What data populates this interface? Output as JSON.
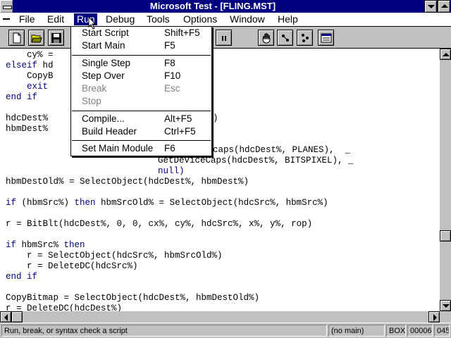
{
  "window": {
    "title": "Microsoft Test - [FLING.MST]"
  },
  "menubar": {
    "items": [
      {
        "name": "file",
        "label": "File"
      },
      {
        "name": "edit",
        "label": "Edit"
      },
      {
        "name": "run",
        "label": "Run"
      },
      {
        "name": "debug",
        "label": "Debug"
      },
      {
        "name": "tools",
        "label": "Tools"
      },
      {
        "name": "options",
        "label": "Options"
      },
      {
        "name": "window",
        "label": "Window"
      },
      {
        "name": "help",
        "label": "Help"
      }
    ],
    "active": "Run"
  },
  "run_menu": {
    "items": [
      {
        "label": "Start Script",
        "shortcut": "Shift+F5",
        "enabled": true
      },
      {
        "label": "Start Main",
        "shortcut": "F5",
        "enabled": true
      },
      {
        "label": "Single Step",
        "shortcut": "F8",
        "enabled": true
      },
      {
        "label": "Step Over",
        "shortcut": "F10",
        "enabled": true
      },
      {
        "label": "Break",
        "shortcut": "Esc",
        "enabled": false
      },
      {
        "label": "Stop",
        "shortcut": "",
        "enabled": false
      },
      {
        "label": "Compile...",
        "shortcut": "Alt+F5",
        "enabled": true
      },
      {
        "label": "Build Header",
        "shortcut": "Ctrl+F5",
        "enabled": true
      },
      {
        "label": "Set Main Module",
        "shortcut": "F6",
        "enabled": true
      }
    ]
  },
  "toolbar": {
    "icons": [
      "new-file-icon",
      "open-folder-icon",
      "save-disk-icon",
      "pause-icon",
      "hand-stop-icon",
      "step-icon",
      "step-over-icon",
      "watch-window-icon"
    ]
  },
  "editor": {
    "lines": [
      "    cy% = ",
      "elseif hd",
      "    CopyB",
      "    exit ",
      "end if",
      "",
      "hdcDest% ",
      "hbmDest% ",
      "",
      "",
      "",
      "",
      "hbmDestOld% = SelectObject(hdcDest%, hbmDest%)",
      "",
      "if (hbmSrc%) then hbmSrcOld% = SelectObject(hdcSrc%, hbmSrc%)",
      "",
      "r = BitBlt(hdcDest%, 0, 0, cx%, cy%, hdcSrc%, x%, y%, rop)",
      "",
      "if hbmSrc% then",
      "    r = SelectObject(hdcSrc%, hbmSrcOld%)",
      "    r = DeleteDC(hdcSrc%)",
      "end if",
      "",
      "CopyBitmap = SelectObject(hdcDest%, hbmDestOld%)",
      "r = DeleteDC(hdcDest%)"
    ],
    "fragments": {
      "line7_tail": ")",
      "line10": "caps(hdcDest%, PLANES),  _",
      "line11": "GetDeviceCaps(hdcDest%, BITSPIXEL), _",
      "line12": "null)"
    }
  },
  "statusbar": {
    "message": "Run, break, or syntax check a script",
    "main_module": "(no main)",
    "mode": "BOX",
    "line": "00006",
    "column": "045"
  }
}
